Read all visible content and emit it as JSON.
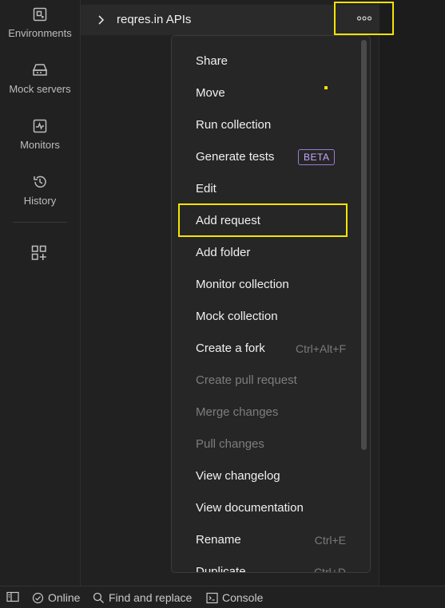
{
  "sidebar": {
    "items": [
      {
        "label": "Environments",
        "icon": "environment-icon"
      },
      {
        "label": "Mock servers",
        "icon": "mock-server-icon"
      },
      {
        "label": "Monitors",
        "icon": "monitor-icon"
      },
      {
        "label": "History",
        "icon": "history-icon"
      }
    ],
    "add_icon": "add-workbench-icon"
  },
  "collection": {
    "name": "reqres.in APIs",
    "more_icon": "more-options-icon"
  },
  "menu": {
    "items": [
      {
        "label": "Share",
        "shortcut": "",
        "disabled": false
      },
      {
        "label": "Move",
        "shortcut": "",
        "disabled": false
      },
      {
        "label": "Run collection",
        "shortcut": "",
        "disabled": false
      },
      {
        "label": "Generate tests",
        "shortcut": "",
        "badge": "BETA",
        "disabled": false
      },
      {
        "label": "Edit",
        "shortcut": "",
        "disabled": false
      },
      {
        "label": "Add request",
        "shortcut": "",
        "disabled": false
      },
      {
        "label": "Add folder",
        "shortcut": "",
        "disabled": false
      },
      {
        "label": "Monitor collection",
        "shortcut": "",
        "disabled": false
      },
      {
        "label": "Mock collection",
        "shortcut": "",
        "disabled": false
      },
      {
        "label": "Create a fork",
        "shortcut": "Ctrl+Alt+F",
        "disabled": false
      },
      {
        "label": "Create pull request",
        "shortcut": "",
        "disabled": true
      },
      {
        "label": "Merge changes",
        "shortcut": "",
        "disabled": true
      },
      {
        "label": "Pull changes",
        "shortcut": "",
        "disabled": true
      },
      {
        "label": "View changelog",
        "shortcut": "",
        "disabled": false
      },
      {
        "label": "View documentation",
        "shortcut": "",
        "disabled": false
      },
      {
        "label": "Rename",
        "shortcut": "Ctrl+E",
        "disabled": false
      },
      {
        "label": "Duplicate",
        "shortcut": "Ctrl+D",
        "disabled": false
      }
    ]
  },
  "statusbar": {
    "online": "Online",
    "find_replace": "Find and replace",
    "console": "Console"
  },
  "colors": {
    "highlight": "#f5e400",
    "beta": "#c5a8ff"
  }
}
